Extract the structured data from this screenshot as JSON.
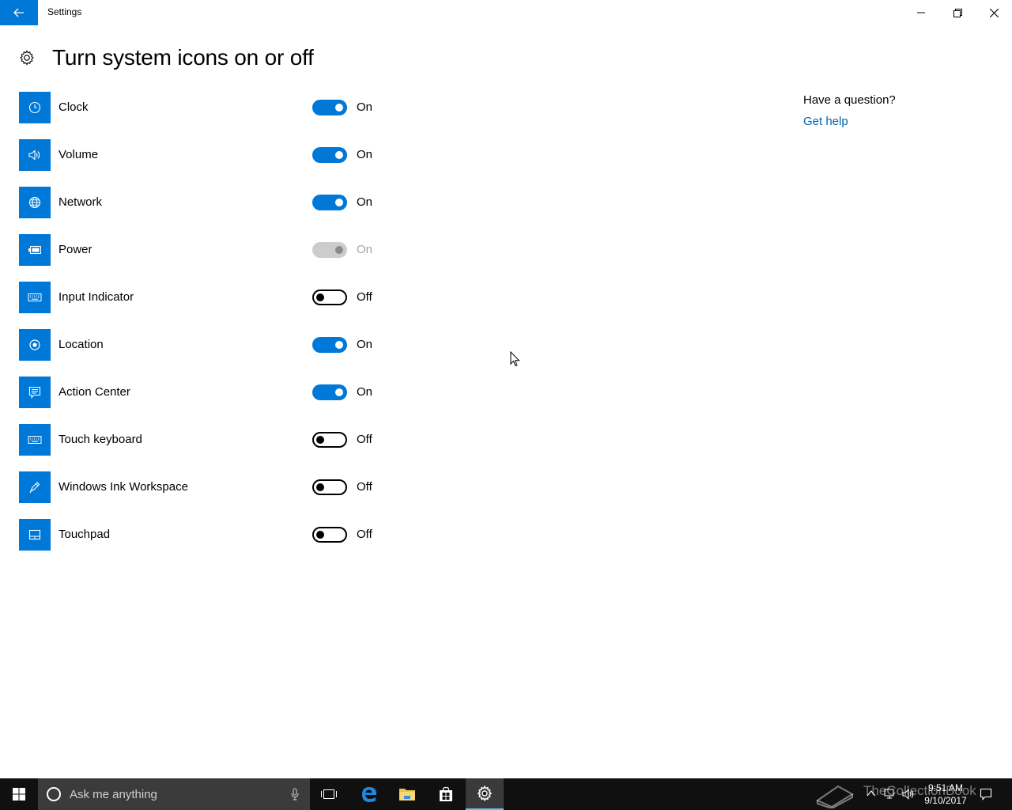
{
  "window": {
    "title": "Settings",
    "page_title": "Turn system icons on or off"
  },
  "items": [
    {
      "label": "Clock",
      "icon": "clock-icon",
      "state": "On",
      "mode": "on"
    },
    {
      "label": "Volume",
      "icon": "volume-icon",
      "state": "On",
      "mode": "on"
    },
    {
      "label": "Network",
      "icon": "globe-icon",
      "state": "On",
      "mode": "on"
    },
    {
      "label": "Power",
      "icon": "battery-icon",
      "state": "On",
      "mode": "disabled"
    },
    {
      "label": "Input Indicator",
      "icon": "keyboard-icon",
      "state": "Off",
      "mode": "off"
    },
    {
      "label": "Location",
      "icon": "location-icon",
      "state": "On",
      "mode": "on"
    },
    {
      "label": "Action Center",
      "icon": "action-center-icon",
      "state": "On",
      "mode": "on"
    },
    {
      "label": "Touch keyboard",
      "icon": "touch-keyboard-icon",
      "state": "Off",
      "mode": "off"
    },
    {
      "label": "Windows Ink Workspace",
      "icon": "pen-icon",
      "state": "Off",
      "mode": "off"
    },
    {
      "label": "Touchpad",
      "icon": "touchpad-icon",
      "state": "Off",
      "mode": "off"
    }
  ],
  "help": {
    "question": "Have a question?",
    "link": "Get help"
  },
  "taskbar": {
    "search_placeholder": "Ask me anything",
    "time": "9:51 AM",
    "date": "9/10/2017",
    "watermark": "TheCollectionBook"
  },
  "colors": {
    "accent": "#0078d7",
    "link": "#0063b1",
    "taskbar": "#101010"
  }
}
